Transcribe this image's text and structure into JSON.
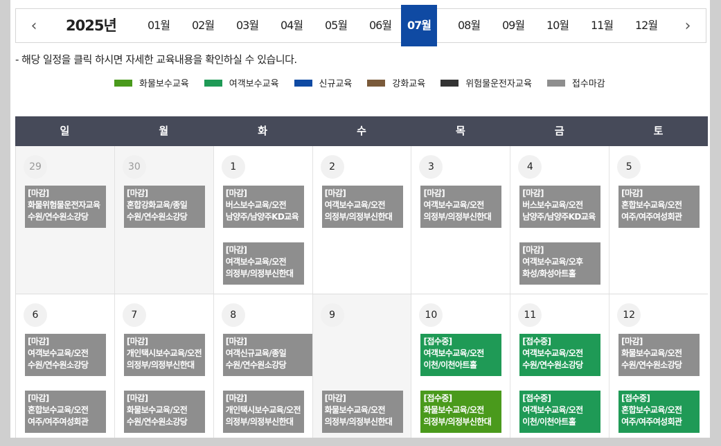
{
  "header": {
    "year": "2025년",
    "prev_icon": "‹",
    "next_icon": "›",
    "months": [
      "01월",
      "02월",
      "03월",
      "04월",
      "05월",
      "06월",
      "07월",
      "08월",
      "09월",
      "10월",
      "11월",
      "12월"
    ],
    "active_month_index": 6
  },
  "notice": "- 해당 일정을 클릭 하시면 자세한 교육내용을 확인하실 수 있습니다.",
  "legend": [
    {
      "label": "화물보수교육",
      "color": "#4a9a1c"
    },
    {
      "label": "여객보수교육",
      "color": "#1f9a56"
    },
    {
      "label": "신규교육",
      "color": "#0f4aa3"
    },
    {
      "label": "강화교육",
      "color": "#7a5a3a"
    },
    {
      "label": "위험물운전자교육",
      "color": "#333333"
    },
    {
      "label": "접수마감",
      "color": "#8e8e8e"
    }
  ],
  "weekdays": [
    "일",
    "월",
    "화",
    "수",
    "목",
    "금",
    "토"
  ],
  "week1": {
    "days": [
      "29",
      "30",
      "1",
      "2",
      "3",
      "4",
      "5"
    ],
    "events": [
      {
        "status": "[마감]",
        "line1": "화물위험물운전자교육",
        "line2": "수원/연수원소강당"
      },
      {
        "status": "[마감]",
        "line1": "혼합강화교육/종일",
        "line2": "수원/연수원소강당"
      },
      {
        "status": "[마감]",
        "line1": "버스보수교육/오전",
        "line2": "남양주/남양주KD교육"
      },
      {
        "status": "[마감]",
        "line1": "여객보수교육/오전",
        "line2": "의정부/의정부신한대"
      },
      {
        "status": "[마감]",
        "line1": "여객보수교육/오전",
        "line2": "의정부/의정부신한대"
      },
      {
        "status": "[마감]",
        "line1": "버스보수교육/오전",
        "line2": "남양주/남양주KD교육"
      },
      {
        "status": "[마감]",
        "line1": "혼합보수교육/오전",
        "line2": "여주/여주여성회관"
      },
      {
        "status": "[마감]",
        "line1": "여객보수교육/오전",
        "line2": "의정부/의정부신한대"
      },
      {
        "status": "[마감]",
        "line1": "여객보수교육/오후",
        "line2": "화성/화성아트홀"
      }
    ]
  },
  "week2": {
    "days": [
      "6",
      "7",
      "8",
      "9",
      "10",
      "11",
      "12"
    ],
    "events": [
      {
        "status": "[마감]",
        "line1": "여객보수교육/오전",
        "line2": "수원/연수원소강당"
      },
      {
        "status": "[마감]",
        "line1": "개인택시보수교육/오전",
        "line2": "의정부/의정부신한대"
      },
      {
        "status": "[마감]",
        "line1": "여객신규교육/종일",
        "line2": "수원/연수원소강당"
      },
      {
        "status": "[접수중]",
        "line1": "여객보수교육/오전",
        "line2": "이천/이천아트홀"
      },
      {
        "status": "[접수중]",
        "line1": "여객보수교육/오전",
        "line2": "수원/연수원소강당"
      },
      {
        "status": "[마감]",
        "line1": "화물보수교육/오전",
        "line2": "수원/연수원소강당"
      },
      {
        "status": "[마감]",
        "line1": "혼합보수교육/오전",
        "line2": "여주/여주여성회관"
      },
      {
        "status": "[마감]",
        "line1": "화물보수교육/오전",
        "line2": "수원/연수원소강당"
      },
      {
        "status": "[마감]",
        "line1": "개인택시보수교육/오전",
        "line2": "의정부/의정부신한대"
      },
      {
        "status": "[마감]",
        "line1": "화물보수교육/오전",
        "line2": "의정부/의정부신한대"
      },
      {
        "status": "[접수중]",
        "line1": "화물보수교육/오전",
        "line2": "의정부/의정부신한대"
      },
      {
        "status": "[접수중]",
        "line1": "여객보수교육/오전",
        "line2": "이천/이천아트홀"
      },
      {
        "status": "[접수중]",
        "line1": "혼합보수교육/오전",
        "line2": "여주/여주여성회관"
      }
    ]
  }
}
